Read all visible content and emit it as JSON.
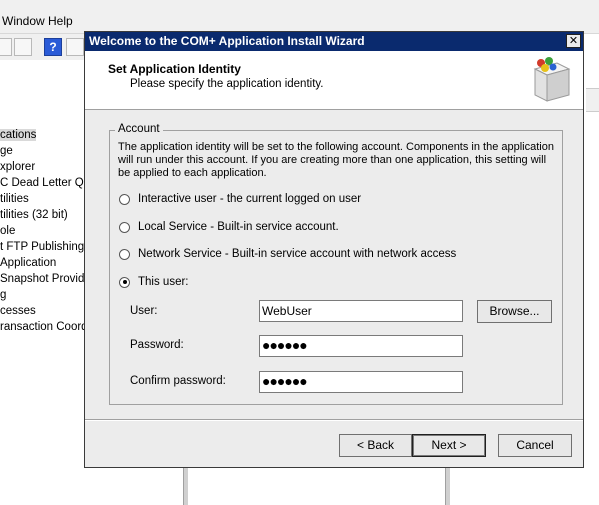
{
  "background": {
    "menu": [
      "Window",
      "Help"
    ],
    "tree_items": [
      {
        "text": "cations",
        "selected": true
      },
      {
        "text": "ge",
        "selected": false
      },
      {
        "text": "xplorer",
        "selected": false
      },
      {
        "text": "C Dead Letter Qu",
        "selected": false
      },
      {
        "text": "tilities",
        "selected": false
      },
      {
        "text": "tilities (32 bit)",
        "selected": false
      },
      {
        "text": "ole",
        "selected": false
      },
      {
        "text": "t FTP Publishing S",
        "selected": false
      },
      {
        "text": "Application",
        "selected": false
      },
      {
        "text": "Snapshot Provide",
        "selected": false
      },
      {
        "text": "g",
        "selected": false
      },
      {
        "text": "cesses",
        "selected": false
      },
      {
        "text": "ransaction Coord",
        "selected": false
      }
    ],
    "help_glyph": "?"
  },
  "wizard": {
    "title": "Welcome to the COM+ Application Install Wizard",
    "close_glyph": "✕",
    "header_title": "Set Application Identity",
    "header_subtitle": "Please specify the application identity.",
    "icon": "package-icon",
    "group_label": "Account",
    "description": "The application identity will be set to the following account.  Components in the application will run under this account.  If you are creating more than one application, this setting will be applied to each application.",
    "options": [
      {
        "label": "Interactive user - the current logged on user",
        "checked": false
      },
      {
        "label": "Local Service - Built-in service account.",
        "checked": false
      },
      {
        "label": "Network Service - Built-in service account with network access",
        "checked": false
      },
      {
        "label": "This user:",
        "checked": true
      }
    ],
    "user_label": "User:",
    "user_value": "WebUser",
    "browse_label": "Browse...",
    "password_label": "Password:",
    "password_value": "●●●●●●",
    "confirm_label": "Confirm password:",
    "confirm_value": "●●●●●●",
    "back_label": "< Back",
    "next_label": "Next >",
    "cancel_label": "Cancel"
  }
}
